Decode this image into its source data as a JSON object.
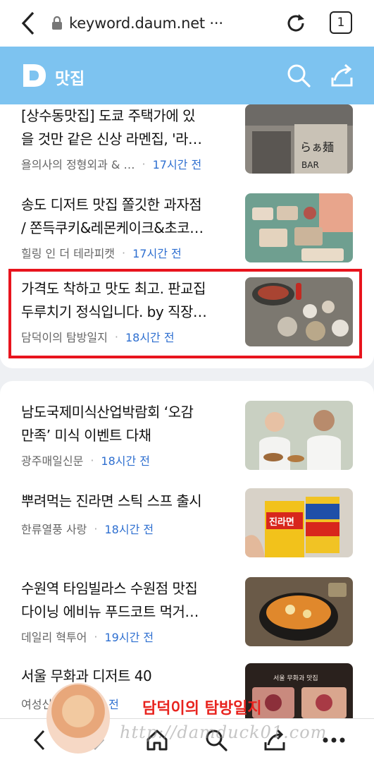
{
  "browser": {
    "url": "keyword.daum.net ···",
    "tab_count": "1"
  },
  "header": {
    "logo_letter": "D",
    "title": "맛집"
  },
  "section1": [
    {
      "title_line1": "[상수동맛집] 도쿄 주택가에 있",
      "title_line2": "을 것만 같은 신상 라멘집, '라…",
      "source": "욜의사의 정형외과 & …",
      "time": "17시간 전"
    },
    {
      "title_line1": "송도 디저트 맛집 쫄깃한 과자점",
      "title_line2": "/ 쫀득쿠키&레몬케이크&초코…",
      "source": "힐링 인 더 테라피캣",
      "time": "17시간 전"
    },
    {
      "title_line1": "가격도 착하고 맛도 최고. 판교집",
      "title_line2": "두루치기 정식입니다. by 직장…",
      "source": "담덕이의 탐방일지",
      "time": "18시간 전"
    }
  ],
  "section2": [
    {
      "title_line1": "남도국제미식산업박람회 ‘오감",
      "title_line2": "만족’ 미식 이벤트 다채",
      "source": "광주매일신문",
      "time": "18시간 전"
    },
    {
      "title_line1": "뿌려먹는 진라면 스틱 스프 출시",
      "title_line2": "",
      "source": "한류열풍 사랑",
      "time": "18시간 전"
    },
    {
      "title_line1": "수원역 타임빌라스 수원점 맛집",
      "title_line2": "다이닝 에비뉴 푸드코트 먹거…",
      "source": "데일리 혁투어",
      "time": "19시간 전"
    },
    {
      "title_line1": "서울 무화과 디저트 40",
      "title_line2": "",
      "source": "여성신",
      "time": "19시간 전"
    }
  ],
  "thumb_texts": {
    "ramen_sign": "らぁ麺",
    "ramen_bar": "BAR",
    "ramyeon_pack": "진라면",
    "fig_caption": "서울 무화과 맛집"
  },
  "watermark": {
    "name": "담덕이의 탐방일지",
    "url": "http://damduck01.com"
  },
  "colors": {
    "header_bg": "#7dc3f0",
    "time_blue": "#2e6fd0",
    "highlight_red": "#e8141d"
  }
}
